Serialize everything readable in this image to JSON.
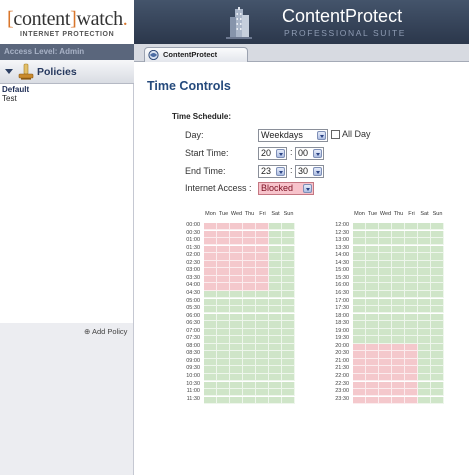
{
  "brand": {
    "logo_bracket_open": "[",
    "logo_word1": "content",
    "logo_bracket_close": "]",
    "logo_word2": "watch",
    "logo_mark": ".",
    "logo_tagline": "INTERNET PROTECTION",
    "product_name": "ContentProtect",
    "product_suite": "PROFESSIONAL SUITE"
  },
  "sidebar": {
    "access_level": "Access Level: Admin",
    "policies_label": "Policies",
    "policies": [
      "Default",
      "Test"
    ],
    "selected_policy": "Default",
    "add_policy_label": "⊕ Add Policy"
  },
  "tab": {
    "label": "ContentProtect",
    "icon": "contentprotect-icon"
  },
  "page": {
    "title": "Time Controls",
    "section": "Time Schedule:"
  },
  "form": {
    "day_label": "Day:",
    "day_value": "Weekdays",
    "all_day_label": "All Day",
    "all_day_checked": false,
    "start_label": "Start Time:",
    "start_hour": "20",
    "start_minute": "00",
    "end_label": "End Time:",
    "end_hour": "23",
    "end_minute": "30",
    "access_label": "Internet Access :",
    "access_value": "Blocked",
    "time_separator": ":"
  },
  "schedule": {
    "days": [
      "Mon",
      "Tue",
      "Wed",
      "Thu",
      "Fri",
      "Sat",
      "Sun"
    ],
    "left_times": [
      "00:00",
      "00:30",
      "01:00",
      "01:30",
      "02:00",
      "02:30",
      "03:00",
      "03:30",
      "04:00",
      "04:30",
      "05:00",
      "05:30",
      "06:00",
      "06:30",
      "07:00",
      "07:30",
      "08:00",
      "08:30",
      "09:00",
      "09:30",
      "10:00",
      "10:30",
      "11:00",
      "11:30"
    ],
    "right_times": [
      "12:00",
      "12:30",
      "13:00",
      "13:30",
      "14:00",
      "14:30",
      "15:00",
      "15:30",
      "16:00",
      "16:30",
      "17:00",
      "17:30",
      "18:00",
      "18:30",
      "19:00",
      "19:30",
      "20:00",
      "20:30",
      "21:00",
      "21:30",
      "22:00",
      "22:30",
      "23:00",
      "23:30"
    ],
    "blocked_days": [
      "Mon",
      "Tue",
      "Wed",
      "Thu",
      "Fri"
    ],
    "left_blocked_slots": [
      "00:00",
      "00:30",
      "01:00",
      "01:30",
      "02:00",
      "02:30",
      "03:00",
      "03:30",
      "04:00"
    ],
    "right_blocked_slots": [
      "20:00",
      "20:30",
      "21:00",
      "21:30",
      "22:00",
      "22:30",
      "23:00",
      "23:30"
    ],
    "colors": {
      "allowed": "#cfe5c8",
      "blocked": "#f4c8cc"
    }
  }
}
